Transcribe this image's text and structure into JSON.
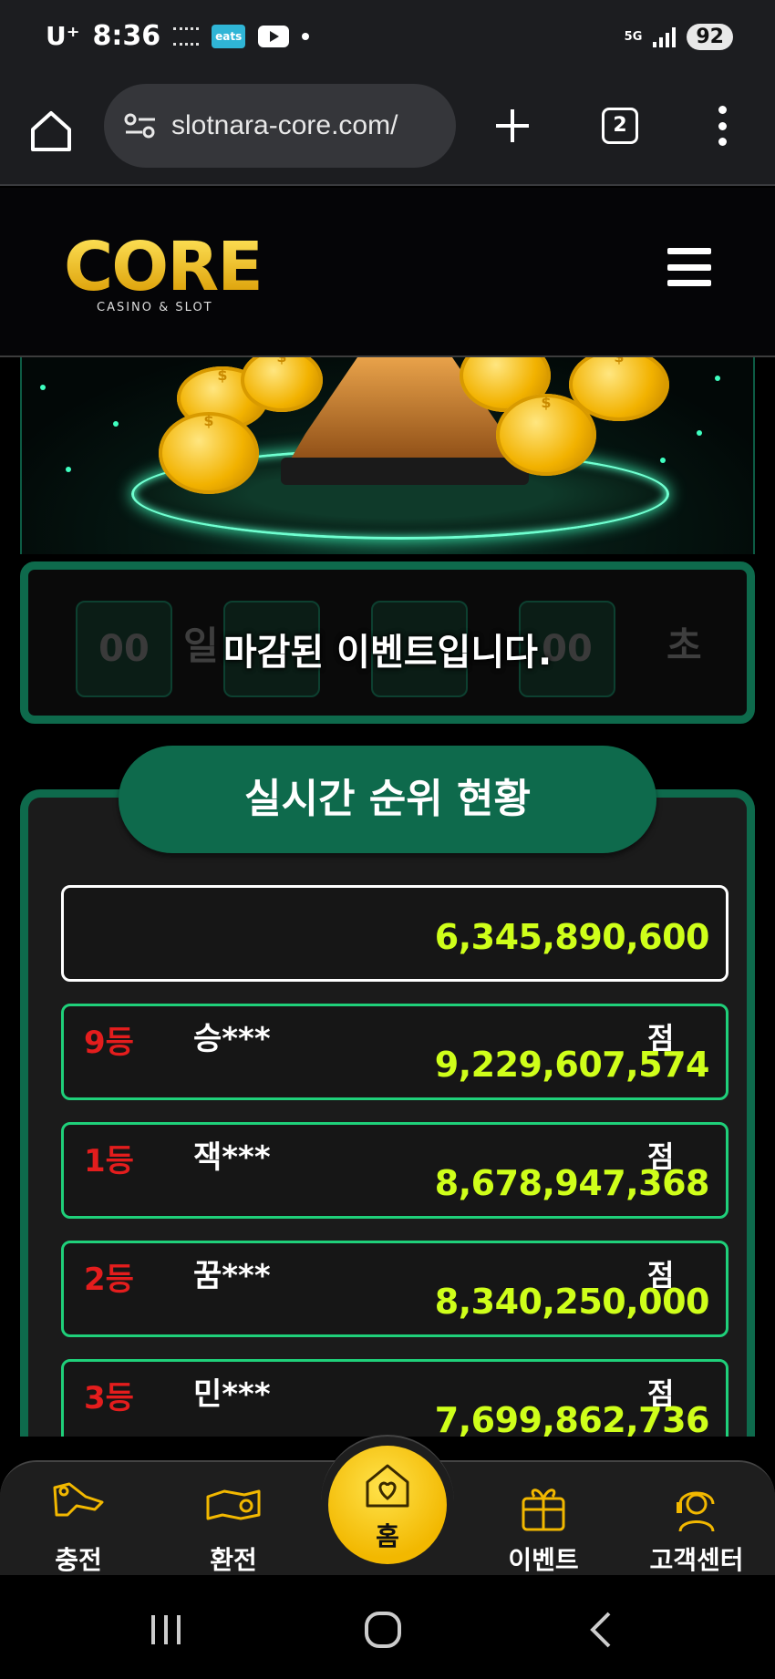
{
  "status_bar": {
    "carrier": "U⁺",
    "time": "8:36",
    "eats_label": "eats",
    "network": "5G",
    "battery": "92"
  },
  "browser": {
    "url": "slotnara-core.com/",
    "tab_count": "2"
  },
  "site": {
    "logo_text": "CORE",
    "logo_subtitle": "CASINO & SLOT"
  },
  "countdown": {
    "days": "00",
    "days_unit": "일",
    "seconds": "00",
    "seconds_unit": "초",
    "closed_message": "마감된 이벤트입니다."
  },
  "ranking": {
    "title": "실시간 순위 현황",
    "total": "6,345,890,600",
    "unit": "점",
    "rows": [
      {
        "place": "9등",
        "name": "승***",
        "score": "9,229,607,574"
      },
      {
        "place": "1등",
        "name": "잭***",
        "score": "8,678,947,368"
      },
      {
        "place": "2등",
        "name": "꿈***",
        "score": "8,340,250,000"
      },
      {
        "place": "3등",
        "name": "민***",
        "score": "7,699,862,736"
      }
    ]
  },
  "bottom_nav": {
    "charge": "충전",
    "exchange": "환전",
    "home": "홈",
    "event": "이벤트",
    "support": "고객센터"
  },
  "colors": {
    "accent_green": "#0e6a4c",
    "score_yellow": "#cfff1a",
    "rank_red": "#e41d1d",
    "gold": "#f2b800"
  }
}
